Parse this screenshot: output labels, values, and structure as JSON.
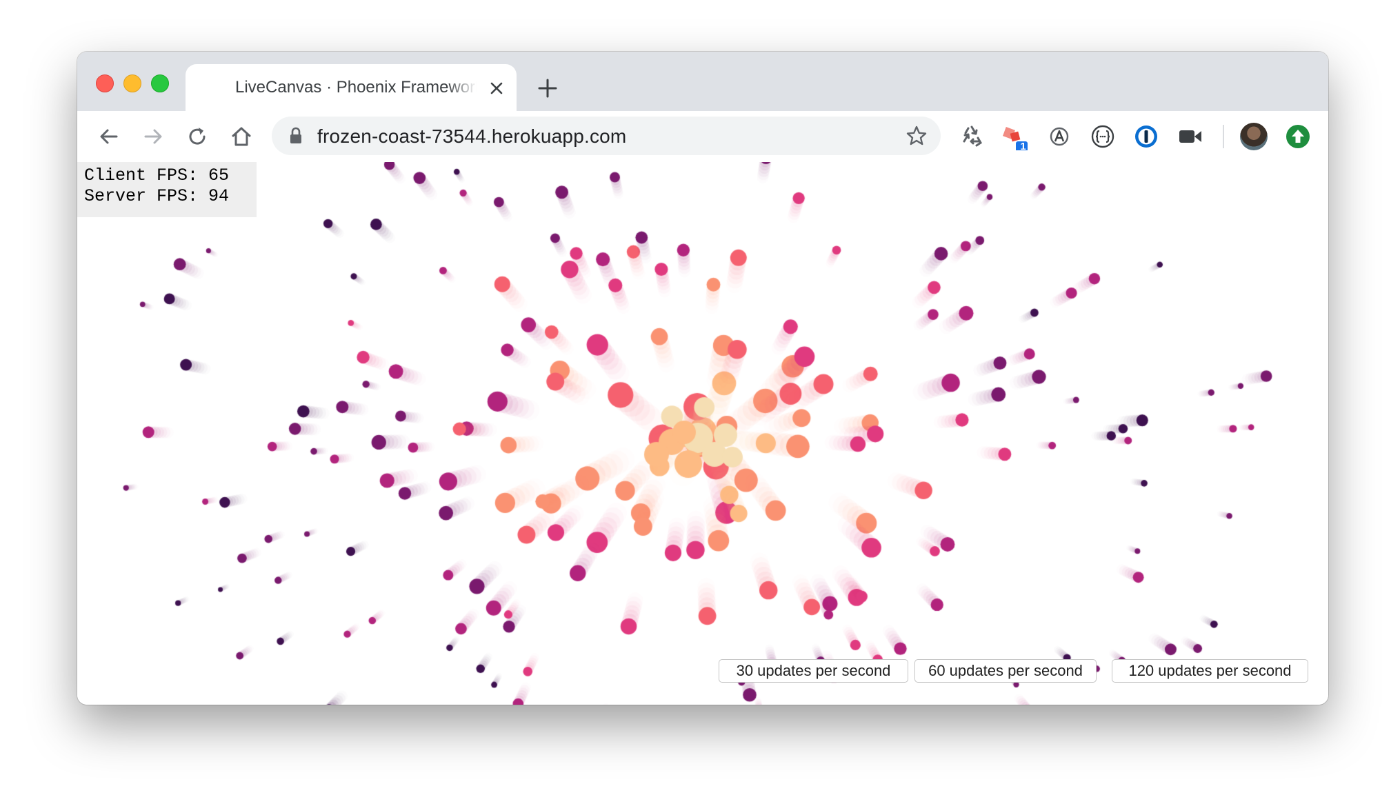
{
  "browser": {
    "tab_title": "LiveCanvas · Phoenix Framework",
    "url": "frozen-coast-73544.herokuapp.com",
    "extension_badge": "1"
  },
  "icons": {
    "back": "arrow-left-icon",
    "forward": "arrow-right-icon",
    "reload": "reload-icon",
    "home": "home-icon",
    "lock": "lock-icon",
    "bookmark": "star-icon",
    "extensions": [
      "recycle-icon",
      "shapes-icon",
      "translate-icon",
      "json-icon",
      "password-manager-icon",
      "video-camera-icon",
      "update-arrow-icon"
    ]
  },
  "fps": {
    "client_label": "Client FPS:",
    "client_value": "65",
    "server_label": "Server FPS:",
    "server_value": "94"
  },
  "rate_buttons": [
    {
      "label": "30 updates per second"
    },
    {
      "label": "60 updates per second"
    },
    {
      "label": "120 updates per second"
    }
  ],
  "particle_colors": [
    "#f5deb3",
    "#fdbb84",
    "#fa9272",
    "#f5616f",
    "#e03a7f",
    "#b2247d",
    "#7a1a6e",
    "#3e1150"
  ]
}
